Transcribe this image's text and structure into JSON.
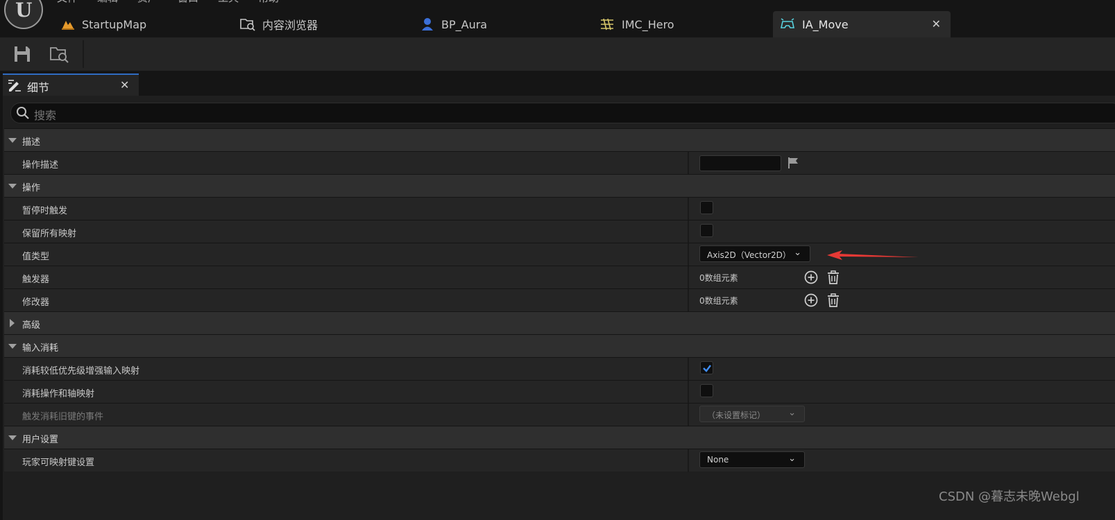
{
  "menu": [
    "文件",
    "编辑",
    "资产",
    "窗口",
    "工具",
    "帮助"
  ],
  "tabs": [
    {
      "label": "StartupMap",
      "icon": "map-icon"
    },
    {
      "label": "内容浏览器",
      "icon": "content-browser-icon"
    },
    {
      "label": "BP_Aura",
      "icon": "blueprint-icon"
    },
    {
      "label": "IMC_Hero",
      "icon": "mapping-context-icon"
    },
    {
      "label": "IA_Move",
      "icon": "input-action-icon",
      "active": true
    }
  ],
  "details": {
    "tab_label": "细节",
    "search_placeholder": "搜索"
  },
  "sections": {
    "description": {
      "label": "描述",
      "action_description": "操作描述"
    },
    "action": {
      "label": "操作",
      "trigger_when_paused": "暂停时触发",
      "reserve_all_mappings": "保留所有映射",
      "value_type": "值类型",
      "value_type_value": "Axis2D（Vector2D）",
      "triggers": "触发器",
      "triggers_count": "0数组元素",
      "modifiers": "修改器",
      "modifiers_count": "0数组元素"
    },
    "advanced": {
      "label": "高级"
    },
    "input_consumption": {
      "label": "输入消耗",
      "consume_lower_priority": "消耗较低优先级增强输入映射",
      "consume_lower_priority_checked": true,
      "consume_action_axis": "消耗操作和轴映射",
      "trigger_legacy_events": "触发消耗旧键的事件",
      "trigger_legacy_value": "（未设置标记）"
    },
    "user_settings": {
      "label": "用户设置",
      "player_mappable_settings": "玩家可映射键设置",
      "player_mappable_value": "None"
    }
  },
  "watermark": "CSDN @暮志未晚Webgl",
  "colors": {
    "accent_blue": "#3f8df5",
    "annotation_red": "#e53935"
  }
}
